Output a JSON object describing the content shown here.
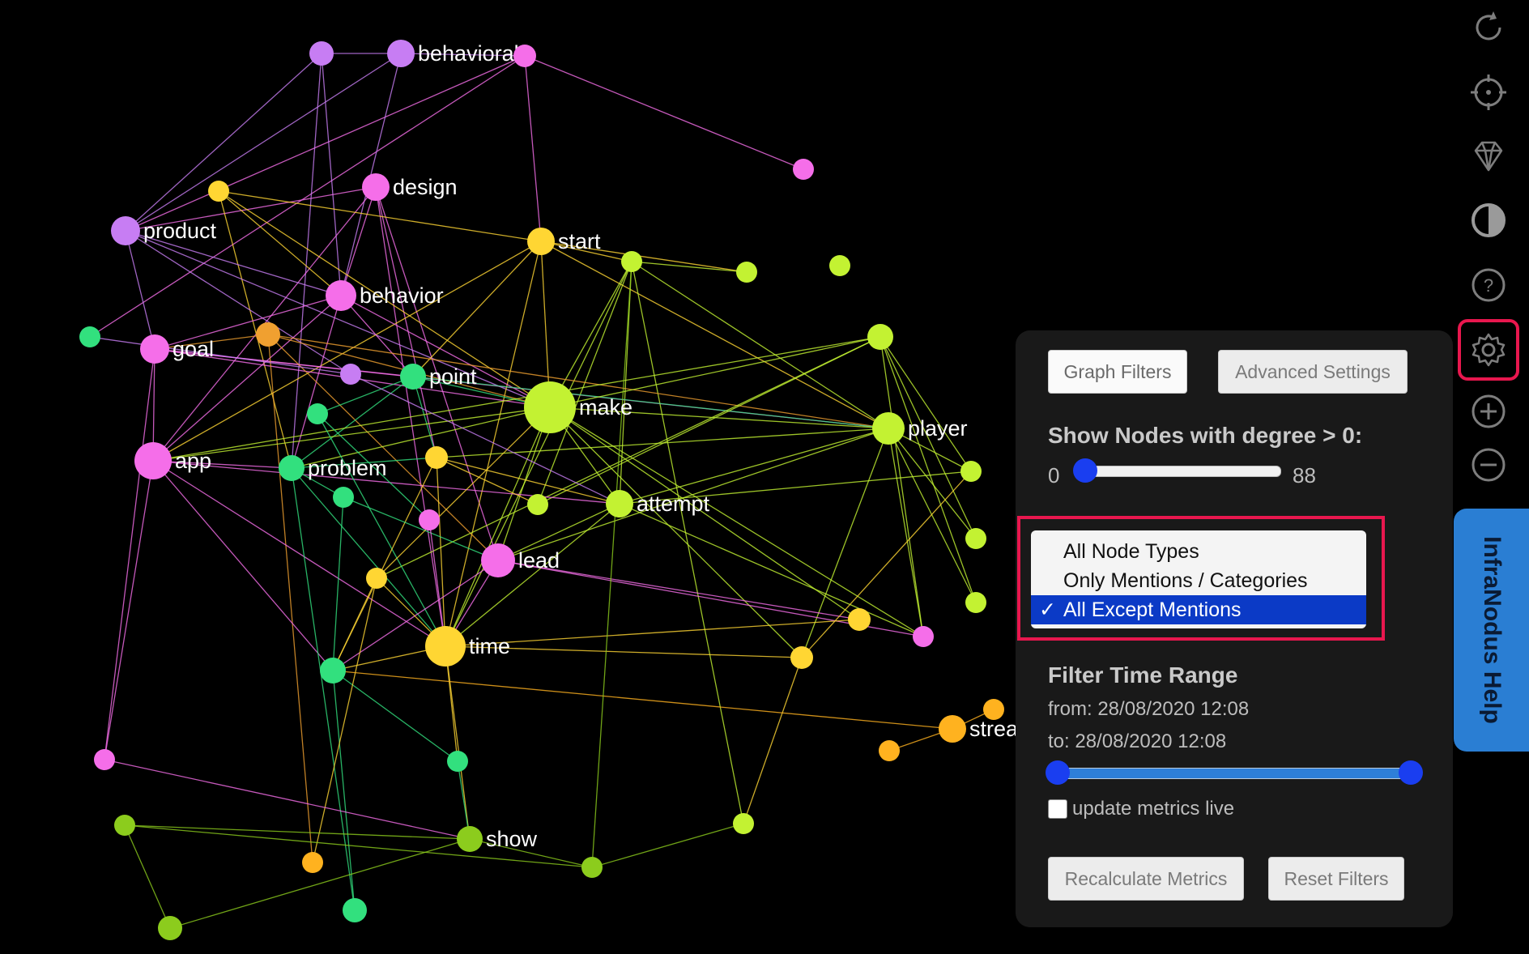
{
  "graph": {
    "nodes": [
      {
        "id": "behavioral",
        "label": "behavioral",
        "color": "#c77df3"
      },
      {
        "id": "design",
        "label": "design",
        "color": "#f56ee9"
      },
      {
        "id": "product",
        "label": "product",
        "color": "#c77df3"
      },
      {
        "id": "start",
        "label": "start",
        "color": "#ffd633"
      },
      {
        "id": "behavior",
        "label": "behavior",
        "color": "#f56ee9"
      },
      {
        "id": "goal",
        "label": "goal",
        "color": "#f56ee9"
      },
      {
        "id": "point",
        "label": "point",
        "color": "#32e07e"
      },
      {
        "id": "make",
        "label": "make",
        "color": "#c3f232"
      },
      {
        "id": "player",
        "label": "player",
        "color": "#c3f232"
      },
      {
        "id": "app",
        "label": "app",
        "color": "#f56ee9"
      },
      {
        "id": "problem",
        "label": "problem",
        "color": "#32e07e"
      },
      {
        "id": "attempt",
        "label": "attempt",
        "color": "#c3f232"
      },
      {
        "id": "lead",
        "label": "lead",
        "color": "#f56ee9"
      },
      {
        "id": "time",
        "label": "time",
        "color": "#ffd633"
      },
      {
        "id": "streak",
        "label": "streak",
        "color": "#ffb21f"
      },
      {
        "id": "show",
        "label": "show",
        "color": "#8ccc1d"
      },
      {
        "id": "n1",
        "label": "",
        "color": "#c77df3"
      },
      {
        "id": "n2",
        "label": "",
        "color": "#f56ee9"
      },
      {
        "id": "n3",
        "label": "",
        "color": "#f56ee9"
      },
      {
        "id": "n4",
        "label": "",
        "color": "#ffd633"
      },
      {
        "id": "n5",
        "label": "",
        "color": "#c3f232"
      },
      {
        "id": "n6",
        "label": "",
        "color": "#c3f232"
      },
      {
        "id": "n7",
        "label": "",
        "color": "#c3f232"
      },
      {
        "id": "n8",
        "label": "",
        "color": "#c3f232"
      },
      {
        "id": "n9",
        "label": "",
        "color": "#32e07e"
      },
      {
        "id": "n10",
        "label": "",
        "color": "#f0a030"
      },
      {
        "id": "n11",
        "label": "",
        "color": "#c77df3"
      },
      {
        "id": "n12",
        "label": "",
        "color": "#32e07e"
      },
      {
        "id": "n13",
        "label": "",
        "color": "#ffd633"
      },
      {
        "id": "n14",
        "label": "",
        "color": "#32e07e"
      },
      {
        "id": "n15",
        "label": "",
        "color": "#f56ee9"
      },
      {
        "id": "n16",
        "label": "",
        "color": "#c3f232"
      },
      {
        "id": "n17",
        "label": "",
        "color": "#ffd633"
      },
      {
        "id": "n18",
        "label": "",
        "color": "#c3f232"
      },
      {
        "id": "n19",
        "label": "",
        "color": "#c3f232"
      },
      {
        "id": "n20",
        "label": "",
        "color": "#c3f232"
      },
      {
        "id": "n21",
        "label": "",
        "color": "#ffd633"
      },
      {
        "id": "n22",
        "label": "",
        "color": "#f56ee9"
      },
      {
        "id": "n23",
        "label": "",
        "color": "#ffd633"
      },
      {
        "id": "n24",
        "label": "",
        "color": "#32e07e"
      },
      {
        "id": "n25",
        "label": "",
        "color": "#32e07e"
      },
      {
        "id": "n26",
        "label": "",
        "color": "#f56ee9"
      },
      {
        "id": "n27",
        "label": "",
        "color": "#ffb21f"
      },
      {
        "id": "n28",
        "label": "",
        "color": "#ffb21f"
      },
      {
        "id": "n29",
        "label": "",
        "color": "#c3f232"
      },
      {
        "id": "n30",
        "label": "",
        "color": "#8ccc1d"
      },
      {
        "id": "n31",
        "label": "",
        "color": "#ffb21f"
      },
      {
        "id": "n32",
        "label": "",
        "color": "#8ccc1d"
      },
      {
        "id": "n33",
        "label": "",
        "color": "#32e07e"
      },
      {
        "id": "n34",
        "label": "",
        "color": "#8ccc1d"
      }
    ],
    "edges": [
      [
        "n1",
        "behavioral"
      ],
      [
        "behavioral",
        "n2"
      ],
      [
        "n2",
        "n3"
      ],
      [
        "n2",
        "start"
      ],
      [
        "n2",
        "n9"
      ],
      [
        "n2",
        "product"
      ],
      [
        "n1",
        "product"
      ],
      [
        "n1",
        "behavior"
      ],
      [
        "n1",
        "problem"
      ],
      [
        "behavioral",
        "behavior"
      ],
      [
        "behavioral",
        "product"
      ],
      [
        "design",
        "product"
      ],
      [
        "design",
        "behavior"
      ],
      [
        "design",
        "app"
      ],
      [
        "design",
        "time"
      ],
      [
        "design",
        "lead"
      ],
      [
        "design",
        "n13"
      ],
      [
        "n4",
        "start"
      ],
      [
        "n4",
        "behavior"
      ],
      [
        "n4",
        "make"
      ],
      [
        "n4",
        "problem"
      ],
      [
        "product",
        "behavior"
      ],
      [
        "product",
        "goal"
      ],
      [
        "product",
        "make"
      ],
      [
        "product",
        "n11"
      ],
      [
        "start",
        "make"
      ],
      [
        "start",
        "app"
      ],
      [
        "start",
        "point"
      ],
      [
        "start",
        "time"
      ],
      [
        "start",
        "n5"
      ],
      [
        "start",
        "player"
      ],
      [
        "start",
        "n6"
      ],
      [
        "n5",
        "n6"
      ],
      [
        "n5",
        "player"
      ],
      [
        "n5",
        "make"
      ],
      [
        "n5",
        "time"
      ],
      [
        "n5",
        "attempt"
      ],
      [
        "n5",
        "n29"
      ],
      [
        "n5",
        "n16"
      ],
      [
        "behavior",
        "goal"
      ],
      [
        "behavior",
        "app"
      ],
      [
        "behavior",
        "point"
      ],
      [
        "behavior",
        "make"
      ],
      [
        "behavior",
        "problem"
      ],
      [
        "goal",
        "app"
      ],
      [
        "goal",
        "make"
      ],
      [
        "goal",
        "point"
      ],
      [
        "goal",
        "n26"
      ],
      [
        "goal",
        "player"
      ],
      [
        "n10",
        "goal"
      ],
      [
        "n10",
        "n31"
      ],
      [
        "n10",
        "make"
      ],
      [
        "n10",
        "lead"
      ],
      [
        "n10",
        "player"
      ],
      [
        "point",
        "make"
      ],
      [
        "point",
        "n13"
      ],
      [
        "point",
        "player"
      ],
      [
        "point",
        "problem"
      ],
      [
        "make",
        "player"
      ],
      [
        "make",
        "app"
      ],
      [
        "make",
        "problem"
      ],
      [
        "make",
        "lead"
      ],
      [
        "make",
        "time"
      ],
      [
        "make",
        "attempt"
      ],
      [
        "make",
        "n21"
      ],
      [
        "make",
        "n23"
      ],
      [
        "make",
        "n22"
      ],
      [
        "player",
        "n18"
      ],
      [
        "player",
        "n19"
      ],
      [
        "player",
        "n20"
      ],
      [
        "player",
        "n22"
      ],
      [
        "player",
        "attempt"
      ],
      [
        "player",
        "n13"
      ],
      [
        "player",
        "lead"
      ],
      [
        "player",
        "n23"
      ],
      [
        "n8",
        "n18"
      ],
      [
        "n8",
        "n20"
      ],
      [
        "n8",
        "n19"
      ],
      [
        "n8",
        "make"
      ],
      [
        "n8",
        "n22"
      ],
      [
        "n8",
        "app"
      ],
      [
        "n8",
        "n16"
      ],
      [
        "n8",
        "n17"
      ],
      [
        "app",
        "problem"
      ],
      [
        "app",
        "time"
      ],
      [
        "app",
        "n24"
      ],
      [
        "app",
        "n26"
      ],
      [
        "app",
        "attempt"
      ],
      [
        "problem",
        "n13"
      ],
      [
        "problem",
        "time"
      ],
      [
        "problem",
        "n33"
      ],
      [
        "problem",
        "n14"
      ],
      [
        "n12",
        "point"
      ],
      [
        "n12",
        "time"
      ],
      [
        "n12",
        "n15"
      ],
      [
        "n13",
        "attempt"
      ],
      [
        "n13",
        "n24"
      ],
      [
        "n13",
        "n16"
      ],
      [
        "n13",
        "time"
      ],
      [
        "n14",
        "n24"
      ],
      [
        "n14",
        "lead"
      ],
      [
        "attempt",
        "lead"
      ],
      [
        "attempt",
        "time"
      ],
      [
        "attempt",
        "n22"
      ],
      [
        "attempt",
        "n18"
      ],
      [
        "lead",
        "time"
      ],
      [
        "lead",
        "n21"
      ],
      [
        "lead",
        "n22"
      ],
      [
        "lead",
        "n24"
      ],
      [
        "time",
        "n24"
      ],
      [
        "time",
        "n25"
      ],
      [
        "time",
        "show"
      ],
      [
        "time",
        "n21"
      ],
      [
        "time",
        "n23"
      ],
      [
        "time",
        "n17"
      ],
      [
        "n24",
        "n25"
      ],
      [
        "n24",
        "n33"
      ],
      [
        "n25",
        "show"
      ],
      [
        "n17",
        "n24"
      ],
      [
        "n17",
        "make"
      ],
      [
        "n17",
        "n31"
      ],
      [
        "n23",
        "n29"
      ],
      [
        "streak",
        "n27"
      ],
      [
        "streak",
        "n28"
      ],
      [
        "streak",
        "n24"
      ],
      [
        "n23",
        "n18"
      ],
      [
        "n26",
        "show"
      ],
      [
        "show",
        "n32"
      ],
      [
        "show",
        "n34"
      ],
      [
        "n30",
        "n32"
      ],
      [
        "n30",
        "show"
      ],
      [
        "n30",
        "n34"
      ],
      [
        "n32",
        "n29"
      ],
      [
        "n32",
        "n5"
      ],
      [
        "n15",
        "time"
      ],
      [
        "n11",
        "n9"
      ],
      [
        "n11",
        "attempt"
      ]
    ]
  },
  "toolbar": {
    "icons": [
      "refresh-icon",
      "target-icon",
      "diamond-icon",
      "contrast-icon",
      "help-icon",
      "gear-icon",
      "zoom-in-icon",
      "zoom-out-icon"
    ]
  },
  "help_tab": {
    "label": "InfraNodus Help"
  },
  "panel": {
    "graph_filters_button": "Graph Filters",
    "advanced_settings_button": "Advanced Settings",
    "degree_heading": "Show Nodes with degree > 0:",
    "degree_min": "0",
    "degree_max": "88",
    "degree_value": 0,
    "node_types": {
      "options": [
        "All Node Types",
        "Only Mentions / Categories",
        "All Except Mentions"
      ],
      "selected": "All Except Mentions",
      "check": "✓"
    },
    "time_heading": "Filter Time Range",
    "time_from": "from: 28/08/2020 12:08",
    "time_to": "to: 28/08/2020 12:08",
    "time_range_fraction": [
      0,
      1
    ],
    "update_live_label": "update metrics live",
    "update_live_checked": false,
    "recalculate_button": "Recalculate Metrics",
    "reset_button": "Reset Filters"
  },
  "colors": {
    "accent": "#1a3ef0",
    "highlight_outline": "#e8174e",
    "help_tab": "#2a7ed3"
  }
}
